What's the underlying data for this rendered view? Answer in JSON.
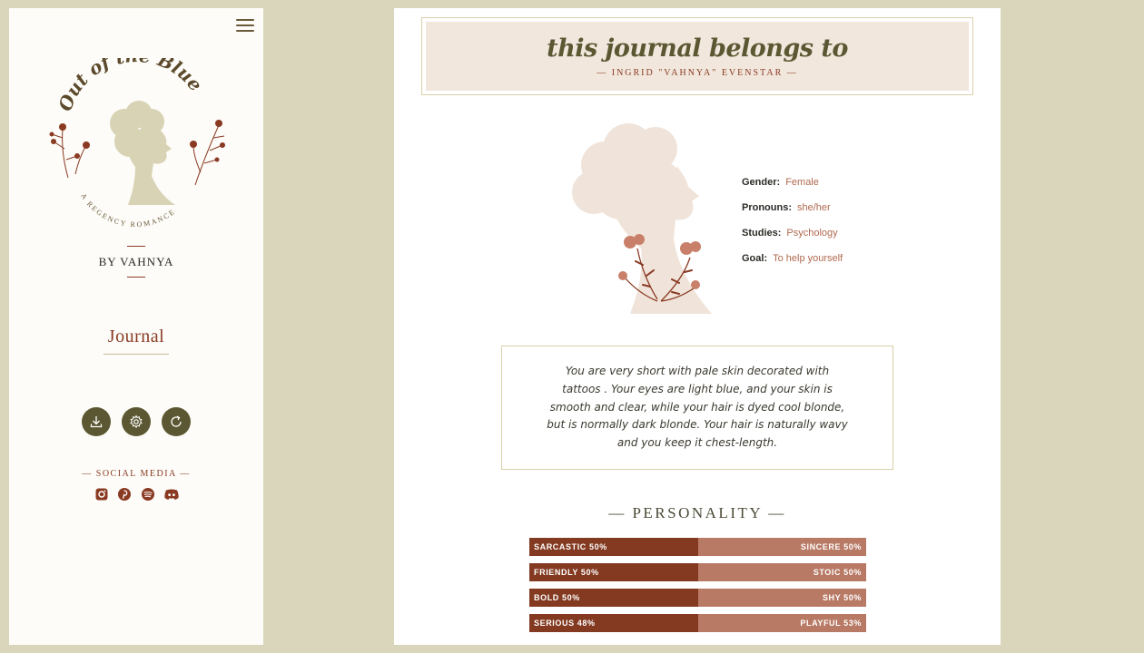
{
  "sidebar": {
    "logo": {
      "title": "Out of the Blue",
      "subtitle": "A REGENCY ROMANCE"
    },
    "by_line": "BY VAHNYA",
    "nav_title": "Journal",
    "actions": [
      {
        "icon": "download-icon"
      },
      {
        "icon": "settings-icon"
      },
      {
        "icon": "refresh-icon"
      }
    ],
    "social_title": "— SOCIAL MEDIA —",
    "social": [
      {
        "icon": "instagram-icon"
      },
      {
        "icon": "pinterest-icon"
      },
      {
        "icon": "spotify-icon"
      },
      {
        "icon": "discord-icon"
      }
    ]
  },
  "header": {
    "title": "this journal belongs to",
    "name": "— INGRID \"VAHNYA\" EVENSTAR —"
  },
  "profile": {
    "stats": [
      {
        "label": "Gender:",
        "value": "Female"
      },
      {
        "label": "Pronouns:",
        "value": "she/her"
      },
      {
        "label": "Studies:",
        "value": "Psychology"
      },
      {
        "label": "Goal:",
        "value": "To help yourself"
      }
    ],
    "description": "You are very short with pale skin decorated with tattoos . Your eyes are light blue, and your skin is smooth and clear, while your hair is dyed cool blonde, but is normally dark blonde. Your hair is naturally wavy and you keep it chest-length."
  },
  "personality": {
    "title": "— PERSONALITY —",
    "traits": [
      {
        "left": "SARCASTIC 50%",
        "right": "SINCERE 50%",
        "left_fraction": 0.5
      },
      {
        "left": "FRIENDLY 50%",
        "right": "STOIC 50%",
        "left_fraction": 0.5
      },
      {
        "left": "BOLD 50%",
        "right": "SHY 50%",
        "left_fraction": 0.5
      },
      {
        "left": "SERIOUS 48%",
        "right": "PLAYFUL 53%",
        "left_fraction": 0.5
      }
    ]
  },
  "colors": {
    "page_bg": "#dad6bc",
    "accent_olive": "#5c5733",
    "accent_rust": "#8a3a23",
    "bar_dark": "#833a21",
    "bar_light": "#b87a65",
    "silhouette": "#f0e4da"
  }
}
